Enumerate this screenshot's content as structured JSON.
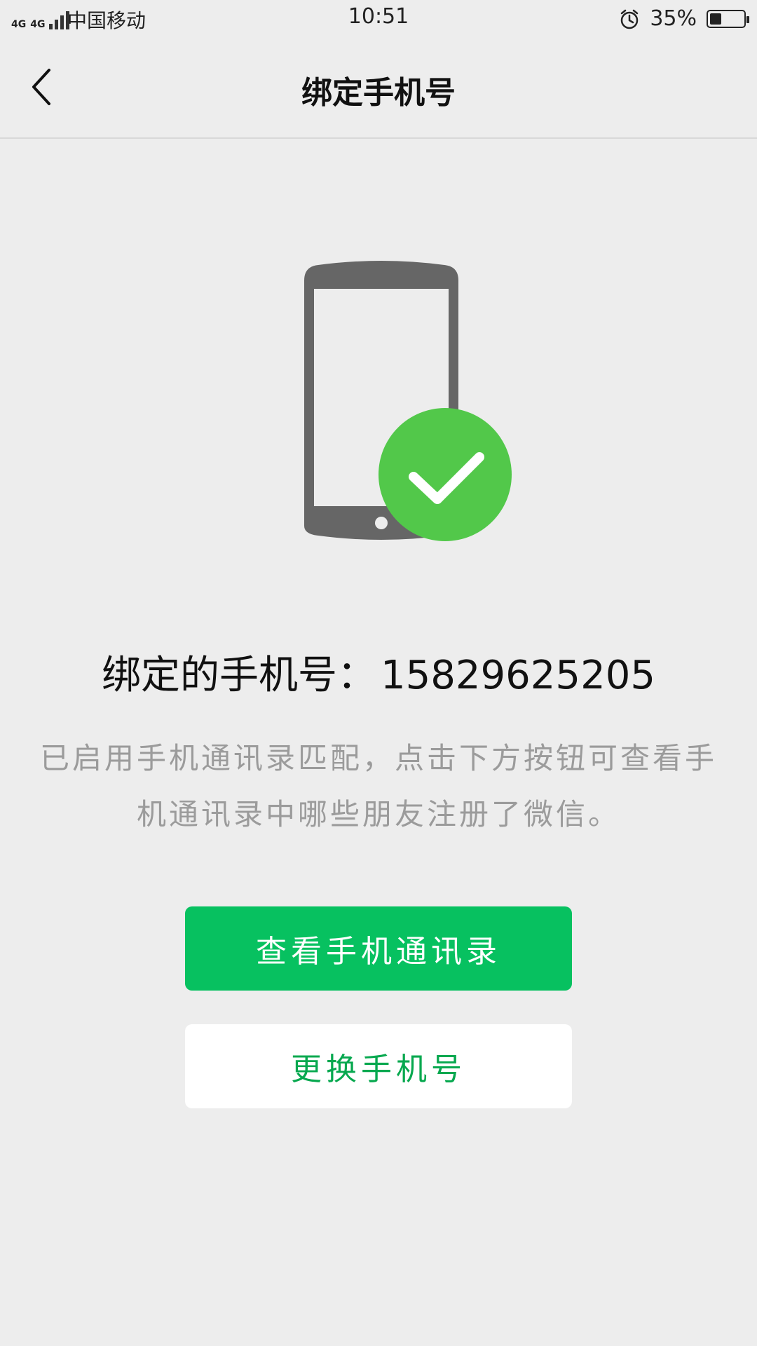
{
  "status_bar": {
    "network_label_1": "4G",
    "network_label_2": "4G",
    "carrier": "中国移动",
    "time": "10:51",
    "alarm_icon": "alarm-clock-icon",
    "battery_percent": "35%",
    "battery_level": 0.35
  },
  "nav": {
    "back_icon": "chevron-left-icon",
    "title": "绑定手机号"
  },
  "illustration": {
    "icon": "phone-check-icon",
    "phone_color": "#666666",
    "check_color": "#52C84A"
  },
  "main": {
    "bound_label": "绑定的手机号：",
    "phone_number": "15829625205",
    "description": "已启用手机通讯录匹配，点击下方按钮可查看手机通讯录中哪些朋友注册了微信。"
  },
  "buttons": {
    "view_contacts": "查看手机通讯录",
    "change_number": "更换手机号"
  },
  "colors": {
    "accent": "#07C160",
    "background": "#EDEDED"
  }
}
